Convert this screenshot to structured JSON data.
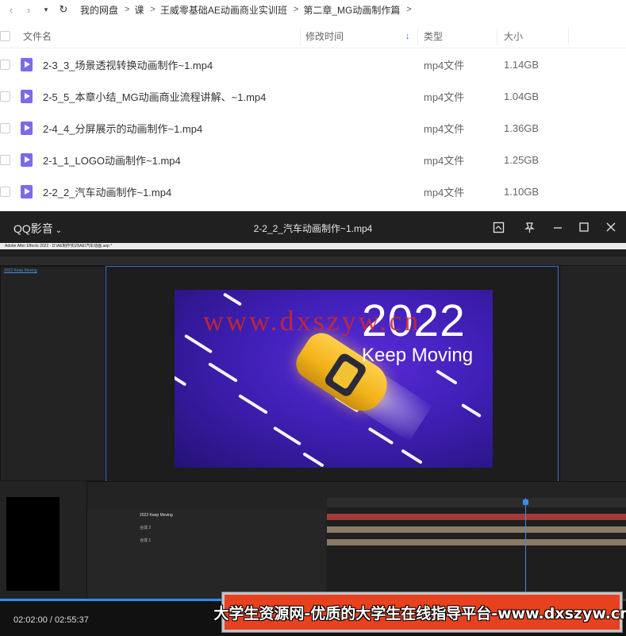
{
  "browser": {
    "breadcrumbs": [
      "我的网盘",
      "课",
      "王威零基础AE动画商业实训班",
      "第二章_MG动画制作篇"
    ],
    "columns": {
      "name": "文件名",
      "modified": "修改时间",
      "type": "类型",
      "size": "大小"
    },
    "files": [
      {
        "name": "2-3_3_场景透视转换动画制作~1.mp4",
        "type": "mp4文件",
        "size": "1.14GB"
      },
      {
        "name": "2-5_5_本章小结_MG动画商业流程讲解、~1.mp4",
        "type": "mp4文件",
        "size": "1.04GB"
      },
      {
        "name": "2-4_4_分屏展示的动画制作~1.mp4",
        "type": "mp4文件",
        "size": "1.36GB"
      },
      {
        "name": "2-1_1_LOGO动画制作~1.mp4",
        "type": "mp4文件",
        "size": "1.25GB"
      },
      {
        "name": "2-2_2_汽车动画制作~1.mp4",
        "type": "mp4文件",
        "size": "1.10GB"
      }
    ]
  },
  "player": {
    "app_name": "QQ影音",
    "title": "2-2_2_汽车动画制作~1.mp4",
    "video": {
      "year_text": "2022",
      "slogan_text": "Keep Moving",
      "watermark": "www.dxszyw.cn",
      "ae_window_title": "Adobe After Effects 2022 - D:\\AE制作实训\\AE\\汽车动画.aep *",
      "ae_layers": [
        "2022 Keep Moving",
        "合成 2",
        "合成 1"
      ],
      "ae_comp_tab": "2022 Keep Moving"
    },
    "current_time": "02:02:00",
    "total_time": "02:55:37",
    "progress": 0.695
  },
  "banner": {
    "text": "大学生资源网-优质的大学生在线指导平台-www.dxszyw.cn"
  }
}
